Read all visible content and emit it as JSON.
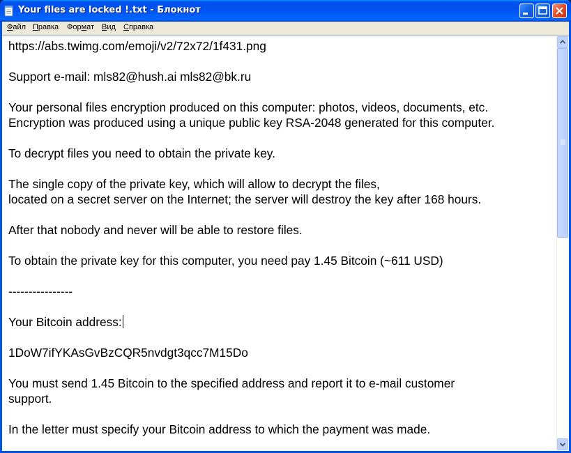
{
  "window": {
    "title": "Your files are locked !.txt - Блокнот",
    "icon": "notepad-icon",
    "controls": {
      "minimize": "minimize-icon",
      "maximize": "maximize-icon",
      "close": "close-icon"
    },
    "colors": {
      "titlebar": "#0054e3",
      "close_button": "#e2502c",
      "menubar": "#ece9d8",
      "editor_bg": "#ffffff"
    }
  },
  "menu": {
    "file": {
      "accel": "Ф",
      "rest": "айл"
    },
    "edit": {
      "accel": "П",
      "rest": "равка"
    },
    "format": {
      "pre": "Фор",
      "accel": "м",
      "rest": "ат"
    },
    "view": {
      "accel": "В",
      "rest": "ид"
    },
    "help": {
      "accel": "С",
      "rest": "правка"
    }
  },
  "document": {
    "lines": [
      "https://abs.twimg.com/emoji/v2/72x72/1f431.png",
      "",
      "Support e-mail: mls82@hush.ai mls82@bk.ru",
      "",
      "Your personal files encryption produced on this computer: photos, videos, documents, etc.",
      "Encryption was produced using a unique public key RSA-2048 generated for this computer.",
      "",
      "To decrypt files you need to obtain the private key.",
      "",
      "The single copy of the private key, which will allow to decrypt the files,",
      "located on a secret server on the Internet; the server will destroy the key after 168 hours.",
      "",
      "After that nobody and never will be able to restore files.",
      "",
      "To obtain the private key for this computer, you need pay 1.45 Bitcoin (~611 USD)",
      "",
      "----------------",
      "",
      "Your Bitcoin address:",
      "",
      "1DoW7ifYKAsGvBzCQR5nvdgt3qcc7M15Do",
      "",
      "You must send 1.45 Bitcoin to the specified address and report it to e-mail customer",
      "support.",
      "",
      "In the letter must specify your Bitcoin address to which the payment was made."
    ],
    "caret_line": 18
  },
  "scrollbar": {
    "up": "scroll-up-arrow-icon",
    "down": "scroll-down-arrow-icon"
  }
}
